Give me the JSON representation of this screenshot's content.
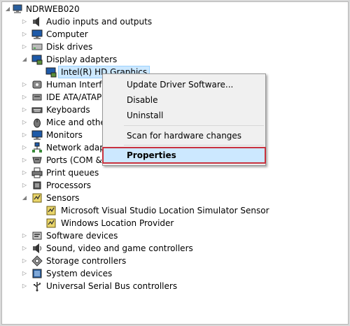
{
  "root": {
    "label": "NDRWEB020",
    "icon": "computer-root-icon"
  },
  "tree": [
    {
      "label": "Audio inputs and outputs",
      "expander": "▷",
      "icon": "speaker-icon"
    },
    {
      "label": "Computer",
      "expander": "▷",
      "icon": "monitor-icon"
    },
    {
      "label": "Disk drives",
      "expander": "▷",
      "icon": "disk-drive-icon"
    },
    {
      "label": "Display adapters",
      "expander": "◢",
      "icon": "display-adapter-icon"
    },
    {
      "label": "Intel(R) HD Graphics",
      "expander": "",
      "icon": "display-adapter-icon",
      "selected": true
    },
    {
      "label": "Human Interfa",
      "expander": "▷",
      "icon": "hid-icon"
    },
    {
      "label": "IDE ATA/ATAP",
      "expander": "▷",
      "icon": "ide-controller-icon"
    },
    {
      "label": "Keyboards",
      "expander": "▷",
      "icon": "keyboard-icon"
    },
    {
      "label": "Mice and other",
      "expander": "▷",
      "icon": "mouse-icon"
    },
    {
      "label": "Monitors",
      "expander": "▷",
      "icon": "monitor-icon"
    },
    {
      "label": "Network adapt",
      "expander": "▷",
      "icon": "network-icon"
    },
    {
      "label": "Ports (COM &",
      "expander": "▷",
      "icon": "port-icon"
    },
    {
      "label": "Print queues",
      "expander": "▷",
      "icon": "printer-icon"
    },
    {
      "label": "Processors",
      "expander": "▷",
      "icon": "processor-icon"
    },
    {
      "label": "Sensors",
      "expander": "◢",
      "icon": "sensor-icon"
    },
    {
      "label": "Microsoft Visual Studio Location Simulator Sensor",
      "expander": "",
      "icon": "sensor-device-icon"
    },
    {
      "label": "Windows Location Provider",
      "expander": "",
      "icon": "sensor-device-icon"
    },
    {
      "label": "Software devices",
      "expander": "▷",
      "icon": "software-device-icon"
    },
    {
      "label": "Sound, video and game controllers",
      "expander": "▷",
      "icon": "sound-icon"
    },
    {
      "label": "Storage controllers",
      "expander": "▷",
      "icon": "storage-controller-icon"
    },
    {
      "label": "System devices",
      "expander": "▷",
      "icon": "system-device-icon"
    },
    {
      "label": "Universal Serial Bus controllers",
      "expander": "▷",
      "icon": "usb-icon"
    }
  ],
  "context_menu": {
    "items": [
      "Update Driver Software...",
      "Disable",
      "Uninstall",
      "Scan for hardware changes",
      "Properties"
    ],
    "highlighted": "Properties",
    "highlight_border_color": "#c8323e"
  }
}
